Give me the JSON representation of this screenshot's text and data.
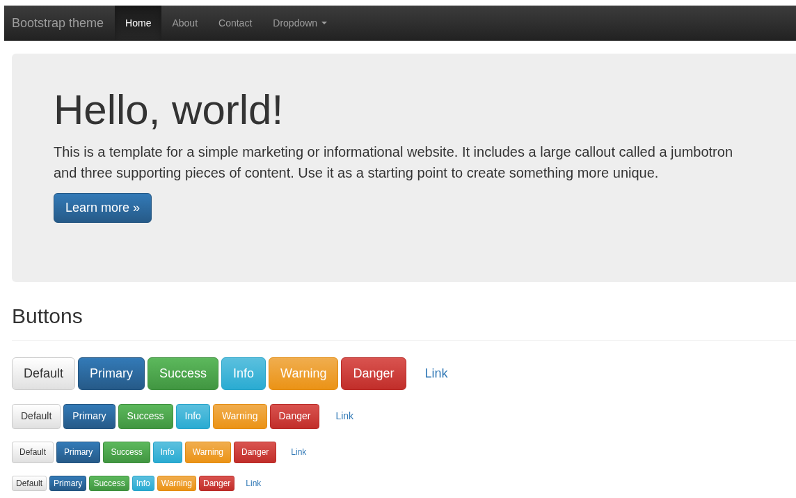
{
  "navbar": {
    "brand": "Bootstrap theme",
    "items": [
      {
        "label": "Home",
        "selected": true,
        "kind": "link"
      },
      {
        "label": "About",
        "selected": false,
        "kind": "link"
      },
      {
        "label": "Contact",
        "selected": false,
        "kind": "link"
      },
      {
        "label": "Dropdown",
        "selected": false,
        "kind": "dropdown"
      }
    ]
  },
  "jumbotron": {
    "heading": "Hello, world!",
    "text": "This is a template for a simple marketing or informational website. It includes a large callout called a jumbotron and three supporting pieces of content. Use it as a starting point to create something more unique.",
    "button": "Learn more »"
  },
  "section": {
    "heading": "Buttons"
  },
  "button_rows": [
    {
      "kind": "lg",
      "buttons": [
        {
          "label": "Default",
          "kind": "default"
        },
        {
          "label": "Primary",
          "kind": "primary"
        },
        {
          "label": "Success",
          "kind": "success"
        },
        {
          "label": "Info",
          "kind": "info"
        },
        {
          "label": "Warning",
          "kind": "warning"
        },
        {
          "label": "Danger",
          "kind": "danger"
        },
        {
          "label": "Link",
          "kind": "link"
        }
      ]
    },
    {
      "kind": "md",
      "buttons": [
        {
          "label": "Default",
          "kind": "default"
        },
        {
          "label": "Primary",
          "kind": "primary"
        },
        {
          "label": "Success",
          "kind": "success"
        },
        {
          "label": "Info",
          "kind": "info"
        },
        {
          "label": "Warning",
          "kind": "warning"
        },
        {
          "label": "Danger",
          "kind": "danger"
        },
        {
          "label": "Link",
          "kind": "link"
        }
      ]
    },
    {
      "kind": "sm",
      "buttons": [
        {
          "label": "Default",
          "kind": "default"
        },
        {
          "label": "Primary",
          "kind": "primary"
        },
        {
          "label": "Success",
          "kind": "success"
        },
        {
          "label": "Info",
          "kind": "info"
        },
        {
          "label": "Warning",
          "kind": "warning"
        },
        {
          "label": "Danger",
          "kind": "danger"
        },
        {
          "label": "Link",
          "kind": "link"
        }
      ]
    },
    {
      "kind": "xs",
      "buttons": [
        {
          "label": "Default",
          "kind": "default"
        },
        {
          "label": "Primary",
          "kind": "primary"
        },
        {
          "label": "Success",
          "kind": "success"
        },
        {
          "label": "Info",
          "kind": "info"
        },
        {
          "label": "Warning",
          "kind": "warning"
        },
        {
          "label": "Danger",
          "kind": "danger"
        },
        {
          "label": "Link",
          "kind": "link"
        }
      ]
    }
  ]
}
